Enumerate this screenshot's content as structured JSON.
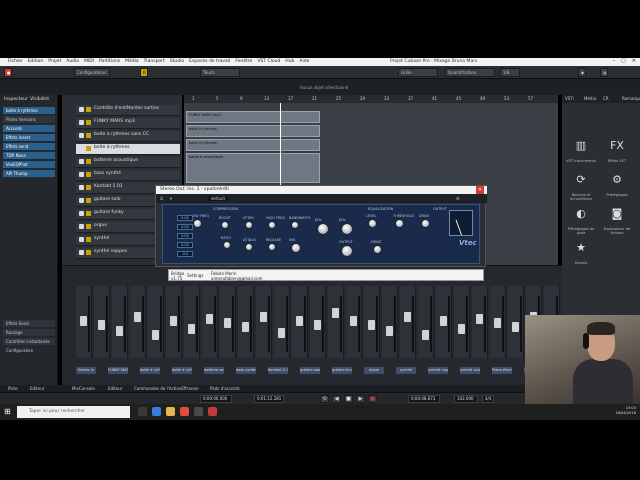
{
  "app": {
    "title": "Projet Cubase Pro - Mixage Bruno Mars",
    "menu": [
      "Fichier",
      "Edition",
      "Projet",
      "Audio",
      "MIDI",
      "Partitions",
      "Média",
      "Transport",
      "Studio",
      "Espaces de travail",
      "Fenêtre",
      "VST Cloud",
      "Hub",
      "Aide"
    ]
  },
  "toolbar": {
    "config_label": "Configurations",
    "touch_label": "Touch",
    "grid_label": "Grille",
    "quant_label": "Quantification",
    "quant_value": "1/8"
  },
  "status": {
    "selection": "Aucun objet sélectionné"
  },
  "inspector": {
    "tabs": [
      "Inspecteur",
      "Visibilité"
    ],
    "items": [
      {
        "label": "boite à rythmes",
        "highlight": true
      },
      {
        "label": "Pistes Versions",
        "highlight": false
      },
      {
        "label": "Accords",
        "highlight": true
      },
      {
        "label": "Effets Insert",
        "highlight": true
      },
      {
        "label": "Effets send",
        "highlight": true
      },
      {
        "label": "TDR Nova",
        "highlight": true
      },
      {
        "label": "VoxEQPhat",
        "highlight": true
      },
      {
        "label": "API Thump",
        "highlight": true
      }
    ],
    "bottom_items": [
      "Effets Send",
      "Routage",
      "Contrôles instantanés",
      "Configuration"
    ]
  },
  "tracks": [
    {
      "name": "Contrôle d'entête/des sorties",
      "selected": false
    },
    {
      "name": "FUNKY MARS mp3",
      "selected": false
    },
    {
      "name": "boite à rythmes sans CC",
      "selected": false
    },
    {
      "name": "boite à rythmes",
      "selected": true
    },
    {
      "name": "batterie acoustique",
      "selected": false
    },
    {
      "name": "bass synthé",
      "selected": false
    },
    {
      "name": "Kontakt 5 01",
      "selected": false
    },
    {
      "name": "guitare solo",
      "selected": false
    },
    {
      "name": "guitare funky",
      "selected": false
    },
    {
      "name": "orgue",
      "selected": false
    },
    {
      "name": "synthé",
      "selected": false
    },
    {
      "name": "synthé nappes",
      "selected": false
    }
  ],
  "ruler": [
    "1",
    "5",
    "9",
    "13",
    "17",
    "21",
    "25",
    "29",
    "33",
    "37",
    "41",
    "45",
    "49",
    "53",
    "57"
  ],
  "clips": [
    {
      "label": "FUNKY MARS mp3"
    },
    {
      "label": "boite à rythmes"
    },
    {
      "label": "boite à rythmes"
    },
    {
      "label": "batterie acoustique"
    }
  ],
  "right_zone": {
    "tabs": [
      "VSTi",
      "Média",
      "CR",
      "Remarque"
    ],
    "items": [
      {
        "icon": "▥",
        "label": "VST Instruments"
      },
      {
        "icon": "FX",
        "label": "Effets VST"
      },
      {
        "icon": "⟳",
        "label": "Boucles et échantillons"
      },
      {
        "icon": "⚙",
        "label": "Préréglages"
      },
      {
        "icon": "◐",
        "label": "Préréglages de piste"
      },
      {
        "icon": "◙",
        "label": "Explorateur de fichiers"
      },
      {
        "icon": "★",
        "label": "Favoris"
      }
    ]
  },
  "plugin": {
    "title": "Stereo Out: Ins. 1 - vpultrelrdti",
    "preset_label": "default",
    "sections": [
      "EQUALIZATION",
      "OUTPUT",
      "COMPRESSION"
    ],
    "knob_labels": [
      "LOW FREQ",
      "BOOST",
      "ATTEN",
      "HIGH FREQ",
      "BANDWIDTH",
      "KHz",
      "KHz",
      "LEVEL",
      "THRESHOLD",
      "DRIVE",
      "RATIO",
      "ATTACK",
      "RELEASE",
      "MIX",
      "OUTPUT",
      "DRIVE"
    ],
    "lcd_values": [
      "0.00",
      "0.00",
      "0.00",
      "0.00",
      "-0.0"
    ],
    "brand": "Vtec"
  },
  "bypass_note": {
    "left": "Bridge",
    "left2": "v1.75",
    "center": "Settings",
    "user": "Fabian Morin",
    "email": "aimerufabien@gmail.com"
  },
  "mixer": {
    "channels": [
      "Stereo In",
      "FUNKY MARS mp3",
      "boite à rythme",
      "boite à rythme",
      "batterie acou",
      "bass synthé",
      "Kontakt 5 01",
      "guitare solo",
      "guitare funky",
      "orgue",
      "synthé",
      "synthé nappes",
      "synthé voix",
      "Piano électriq",
      "Stereo Out"
    ]
  },
  "zone_tabs": [
    "Piste",
    "Editeur",
    "MixConsole",
    "Editeur",
    "Commandes de l'ActionEffrasser",
    "Pads d'accords"
  ],
  "transport": {
    "pos1": "0:00:00.000",
    "pos2": "0:01:12.281",
    "pos3": "0:00:48.873",
    "tempo": "102.000",
    "extra": "4/4"
  },
  "taskbar": {
    "search_placeholder": "Taper ici pour rechercher",
    "time": "15:03",
    "date": "16/04/2018"
  },
  "colors": {
    "accent": "#2b5f8c",
    "record": "#d43a2f",
    "plugin_face": "#1a2a4a"
  }
}
